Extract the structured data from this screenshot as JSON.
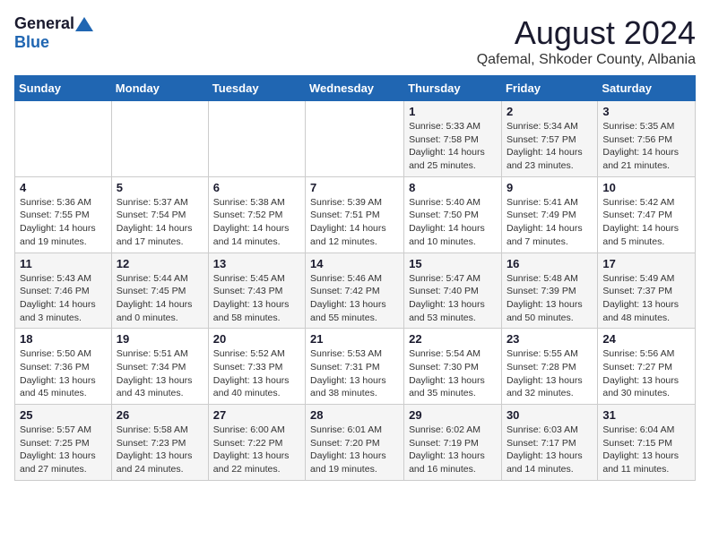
{
  "logo": {
    "general": "General",
    "blue": "Blue"
  },
  "title": {
    "month_year": "August 2024",
    "location": "Qafemal, Shkoder County, Albania"
  },
  "weekdays": [
    "Sunday",
    "Monday",
    "Tuesday",
    "Wednesday",
    "Thursday",
    "Friday",
    "Saturday"
  ],
  "weeks": [
    [
      {
        "day": "",
        "detail": ""
      },
      {
        "day": "",
        "detail": ""
      },
      {
        "day": "",
        "detail": ""
      },
      {
        "day": "",
        "detail": ""
      },
      {
        "day": "1",
        "detail": "Sunrise: 5:33 AM\nSunset: 7:58 PM\nDaylight: 14 hours\nand 25 minutes."
      },
      {
        "day": "2",
        "detail": "Sunrise: 5:34 AM\nSunset: 7:57 PM\nDaylight: 14 hours\nand 23 minutes."
      },
      {
        "day": "3",
        "detail": "Sunrise: 5:35 AM\nSunset: 7:56 PM\nDaylight: 14 hours\nand 21 minutes."
      }
    ],
    [
      {
        "day": "4",
        "detail": "Sunrise: 5:36 AM\nSunset: 7:55 PM\nDaylight: 14 hours\nand 19 minutes."
      },
      {
        "day": "5",
        "detail": "Sunrise: 5:37 AM\nSunset: 7:54 PM\nDaylight: 14 hours\nand 17 minutes."
      },
      {
        "day": "6",
        "detail": "Sunrise: 5:38 AM\nSunset: 7:52 PM\nDaylight: 14 hours\nand 14 minutes."
      },
      {
        "day": "7",
        "detail": "Sunrise: 5:39 AM\nSunset: 7:51 PM\nDaylight: 14 hours\nand 12 minutes."
      },
      {
        "day": "8",
        "detail": "Sunrise: 5:40 AM\nSunset: 7:50 PM\nDaylight: 14 hours\nand 10 minutes."
      },
      {
        "day": "9",
        "detail": "Sunrise: 5:41 AM\nSunset: 7:49 PM\nDaylight: 14 hours\nand 7 minutes."
      },
      {
        "day": "10",
        "detail": "Sunrise: 5:42 AM\nSunset: 7:47 PM\nDaylight: 14 hours\nand 5 minutes."
      }
    ],
    [
      {
        "day": "11",
        "detail": "Sunrise: 5:43 AM\nSunset: 7:46 PM\nDaylight: 14 hours\nand 3 minutes."
      },
      {
        "day": "12",
        "detail": "Sunrise: 5:44 AM\nSunset: 7:45 PM\nDaylight: 14 hours\nand 0 minutes."
      },
      {
        "day": "13",
        "detail": "Sunrise: 5:45 AM\nSunset: 7:43 PM\nDaylight: 13 hours\nand 58 minutes."
      },
      {
        "day": "14",
        "detail": "Sunrise: 5:46 AM\nSunset: 7:42 PM\nDaylight: 13 hours\nand 55 minutes."
      },
      {
        "day": "15",
        "detail": "Sunrise: 5:47 AM\nSunset: 7:40 PM\nDaylight: 13 hours\nand 53 minutes."
      },
      {
        "day": "16",
        "detail": "Sunrise: 5:48 AM\nSunset: 7:39 PM\nDaylight: 13 hours\nand 50 minutes."
      },
      {
        "day": "17",
        "detail": "Sunrise: 5:49 AM\nSunset: 7:37 PM\nDaylight: 13 hours\nand 48 minutes."
      }
    ],
    [
      {
        "day": "18",
        "detail": "Sunrise: 5:50 AM\nSunset: 7:36 PM\nDaylight: 13 hours\nand 45 minutes."
      },
      {
        "day": "19",
        "detail": "Sunrise: 5:51 AM\nSunset: 7:34 PM\nDaylight: 13 hours\nand 43 minutes."
      },
      {
        "day": "20",
        "detail": "Sunrise: 5:52 AM\nSunset: 7:33 PM\nDaylight: 13 hours\nand 40 minutes."
      },
      {
        "day": "21",
        "detail": "Sunrise: 5:53 AM\nSunset: 7:31 PM\nDaylight: 13 hours\nand 38 minutes."
      },
      {
        "day": "22",
        "detail": "Sunrise: 5:54 AM\nSunset: 7:30 PM\nDaylight: 13 hours\nand 35 minutes."
      },
      {
        "day": "23",
        "detail": "Sunrise: 5:55 AM\nSunset: 7:28 PM\nDaylight: 13 hours\nand 32 minutes."
      },
      {
        "day": "24",
        "detail": "Sunrise: 5:56 AM\nSunset: 7:27 PM\nDaylight: 13 hours\nand 30 minutes."
      }
    ],
    [
      {
        "day": "25",
        "detail": "Sunrise: 5:57 AM\nSunset: 7:25 PM\nDaylight: 13 hours\nand 27 minutes."
      },
      {
        "day": "26",
        "detail": "Sunrise: 5:58 AM\nSunset: 7:23 PM\nDaylight: 13 hours\nand 24 minutes."
      },
      {
        "day": "27",
        "detail": "Sunrise: 6:00 AM\nSunset: 7:22 PM\nDaylight: 13 hours\nand 22 minutes."
      },
      {
        "day": "28",
        "detail": "Sunrise: 6:01 AM\nSunset: 7:20 PM\nDaylight: 13 hours\nand 19 minutes."
      },
      {
        "day": "29",
        "detail": "Sunrise: 6:02 AM\nSunset: 7:19 PM\nDaylight: 13 hours\nand 16 minutes."
      },
      {
        "day": "30",
        "detail": "Sunrise: 6:03 AM\nSunset: 7:17 PM\nDaylight: 13 hours\nand 14 minutes."
      },
      {
        "day": "31",
        "detail": "Sunrise: 6:04 AM\nSunset: 7:15 PM\nDaylight: 13 hours\nand 11 minutes."
      }
    ]
  ]
}
